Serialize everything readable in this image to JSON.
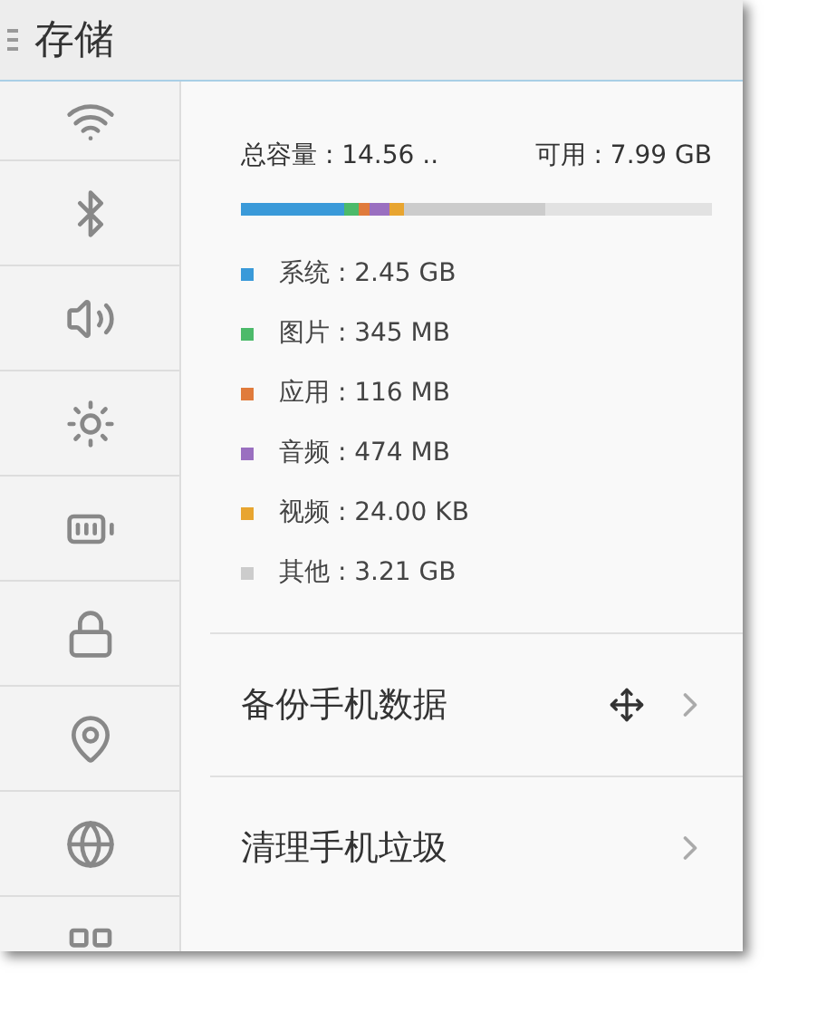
{
  "header": {
    "title": "存储"
  },
  "storage": {
    "total": "总容量 : 14.56  ..",
    "available": "可用 : 7.99 GB",
    "segments": [
      {
        "color": "#3a9ad9"
      },
      {
        "color": "#4cba6a"
      },
      {
        "color": "#e07b3c"
      },
      {
        "color": "#9a6fc0"
      },
      {
        "color": "#e8a530"
      },
      {
        "color": "#cccccc"
      }
    ],
    "legend": [
      {
        "label": "系统 : 2.45 GB",
        "color": "#3a9ad9"
      },
      {
        "label": "图片 : 345 MB",
        "color": "#4cba6a"
      },
      {
        "label": "应用 : 116 MB",
        "color": "#e07b3c"
      },
      {
        "label": "音频 : 474 MB",
        "color": "#9a6fc0"
      },
      {
        "label": "视频 : 24.00 KB",
        "color": "#e8a530"
      },
      {
        "label": "其他 : 3.21 GB",
        "color": "#cccccc"
      }
    ]
  },
  "menu": [
    {
      "label": "备份手机数据",
      "cursor": true
    },
    {
      "label": "清理手机垃圾",
      "cursor": false
    }
  ]
}
